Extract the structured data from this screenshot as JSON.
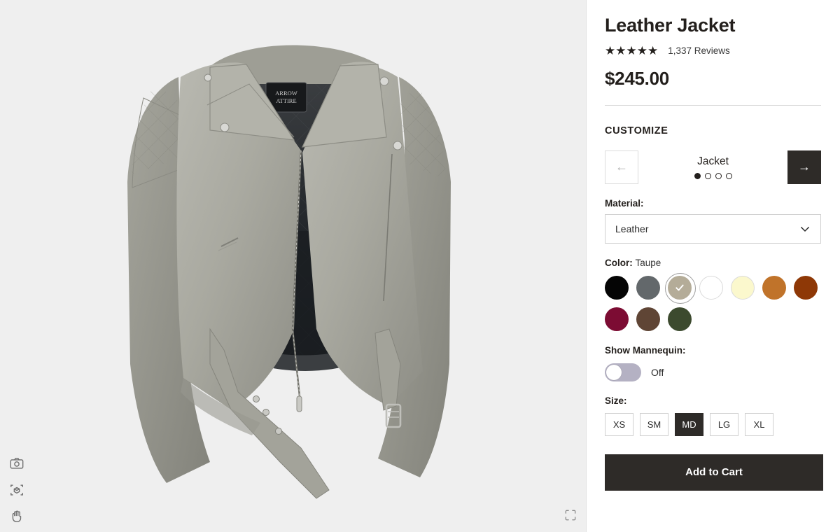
{
  "viewer": {
    "background_color": "#efefef",
    "product_brand_label": "ARROW ATTIRE",
    "tools": [
      {
        "name": "camera-icon",
        "label": "Take Screenshot"
      },
      {
        "name": "ar-view-icon",
        "label": "View in 3D / AR"
      },
      {
        "name": "hand-icon",
        "label": "Pan and Rotate"
      }
    ],
    "fullscreen_label": "Fullscreen"
  },
  "product": {
    "title": "Leather Jacket",
    "stars": "★★★★★",
    "star_count": 5,
    "reviews": "1,337 Reviews",
    "price": "$245.00"
  },
  "customize": {
    "heading": "CUSTOMIZE",
    "prev_arrow": "←",
    "next_arrow": "→",
    "step_label": "Jacket",
    "step_count": 4,
    "active_step": 1,
    "material": {
      "label": "Material:",
      "value": "Leather",
      "options": [
        "Leather"
      ]
    },
    "color": {
      "label": "Color:",
      "value": "Taupe",
      "selected_index": 2,
      "swatches": [
        {
          "name": "Black",
          "hex": "#050505"
        },
        {
          "name": "Gray",
          "hex": "#63686b"
        },
        {
          "name": "Taupe",
          "hex": "#b4ac98"
        },
        {
          "name": "White",
          "hex": "#ffffff"
        },
        {
          "name": "Cream",
          "hex": "#fbf8cd"
        },
        {
          "name": "Tan",
          "hex": "#c0732a"
        },
        {
          "name": "Rust",
          "hex": "#8e3806"
        },
        {
          "name": "Burgundy",
          "hex": "#7c0c33"
        },
        {
          "name": "Brown",
          "hex": "#5f4535"
        },
        {
          "name": "Olive Green",
          "hex": "#3c4a2e"
        }
      ]
    },
    "mannequin": {
      "label": "Show Mannequin:",
      "state": "Off",
      "on": false
    },
    "size": {
      "label": "Size:",
      "selected": "MD",
      "options": [
        "XS",
        "SM",
        "MD",
        "LG",
        "XL"
      ]
    }
  },
  "actions": {
    "add_to_cart": "Add to Cart"
  },
  "theme": {
    "accent_dark": "#2e2b28",
    "text": "#231f1c",
    "border": "#cfcfcf"
  }
}
